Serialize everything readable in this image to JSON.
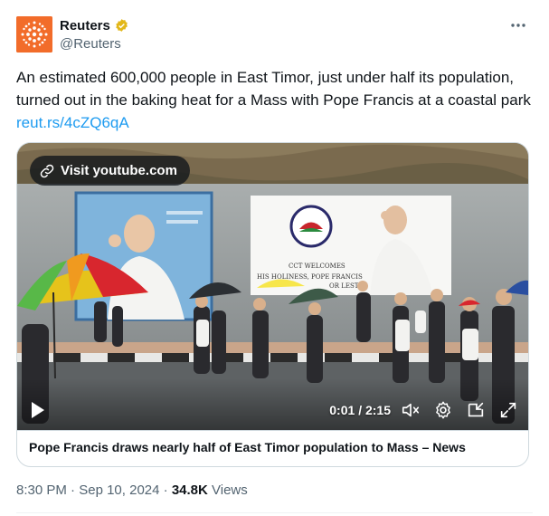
{
  "author": {
    "name": "Reuters",
    "handle": "@Reuters",
    "verified": true,
    "brand_color": "#f26c2a"
  },
  "more_icon": "more-horizontal-icon",
  "tweet": {
    "text": "An estimated 600,000 people in East Timor, just under half its population, turned out in the baking heat for a Mass with Pope Francis at a coastal park",
    "link": "reut.rs/4cZQ6qA",
    "link_color": "#1d9bf0"
  },
  "video": {
    "visit_label": "Visit youtube.com",
    "current_time": "0:01",
    "separator": "/",
    "duration": "2:15",
    "progress": 0.007,
    "icons": [
      "play-icon",
      "mute-icon",
      "settings-icon",
      "picture-in-picture-icon",
      "fullscreen-icon"
    ],
    "banner_text": {
      "welcome": "CCT WELCOMES",
      "holiness": "HIS HOLINESS, POPE FRANCIS",
      "leste": "OR LESTE",
      "seal": "CCT"
    }
  },
  "card": {
    "title": "Pope Francis draws nearly half of East Timor population to Mass – News"
  },
  "meta": {
    "time": "8:30 PM",
    "dot1": "·",
    "date": "Sep 10, 2024",
    "dot2": "·",
    "views_count": "34.8K",
    "views_label": "Views"
  }
}
